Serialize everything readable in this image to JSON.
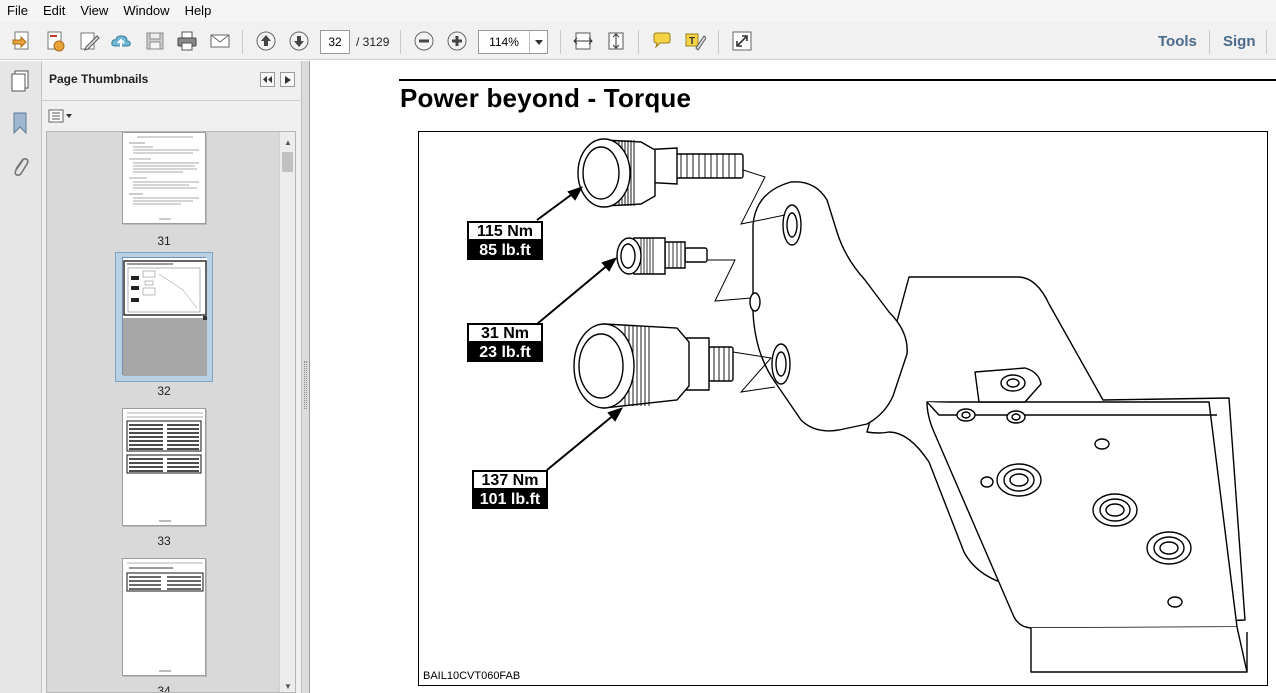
{
  "menu": [
    "File",
    "Edit",
    "View",
    "Window",
    "Help"
  ],
  "toolbar": {
    "page_current": "32",
    "page_total": "/ 3129",
    "zoom": "114%",
    "tools_label": "Tools",
    "sign_label": "Sign"
  },
  "panel": {
    "title": "Page Thumbnails",
    "thumbnails": [
      {
        "label": "31"
      },
      {
        "label": "32",
        "selected": true
      },
      {
        "label": "33"
      },
      {
        "label": "34"
      }
    ]
  },
  "document": {
    "title": "Power beyond - Torque",
    "figure_code": "BAIL10CVT060FAB",
    "callouts": [
      {
        "nm": "115 Nm",
        "lbft": "85 lb.ft"
      },
      {
        "nm": "31 Nm",
        "lbft": "23 lb.ft"
      },
      {
        "nm": "137 Nm",
        "lbft": "101 lb.ft"
      }
    ]
  }
}
